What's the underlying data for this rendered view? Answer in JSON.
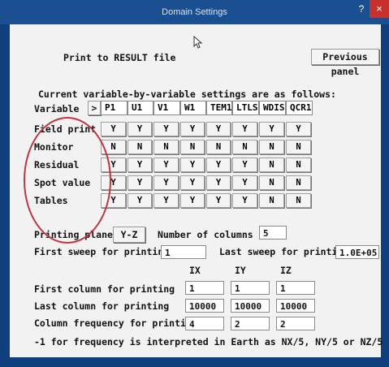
{
  "window": {
    "title": "Domain Settings",
    "help": "?",
    "close": "×"
  },
  "header": {
    "print_label": "Print to RESULT file",
    "prev_button": "Previous panel"
  },
  "settings_caption": "Current variable-by-variable settings are as follows:",
  "table": {
    "variable_label": "Variable",
    "next_button": ">",
    "variables": [
      "P1",
      "U1",
      "V1",
      "W1",
      "TEM1",
      "LTLS",
      "WDIS",
      "QCR1"
    ],
    "rows": [
      {
        "label": "Field print",
        "values": [
          "Y",
          "Y",
          "Y",
          "Y",
          "Y",
          "Y",
          "Y",
          "Y"
        ]
      },
      {
        "label": "Monitor",
        "values": [
          "N",
          "N",
          "N",
          "N",
          "N",
          "N",
          "N",
          "N"
        ]
      },
      {
        "label": "Residual",
        "values": [
          "Y",
          "Y",
          "Y",
          "Y",
          "Y",
          "Y",
          "N",
          "N"
        ]
      },
      {
        "label": "Spot value",
        "values": [
          "Y",
          "Y",
          "Y",
          "Y",
          "Y",
          "Y",
          "N",
          "N"
        ]
      },
      {
        "label": "Tables",
        "values": [
          "Y",
          "Y",
          "Y",
          "Y",
          "Y",
          "Y",
          "N",
          "N"
        ]
      }
    ]
  },
  "printing": {
    "plane_label": "Printing plane",
    "plane_value": "Y-Z",
    "columns_label": "Number of columns",
    "columns_value": "5",
    "first_sweep_label": "First sweep for printing",
    "first_sweep_value": "1",
    "last_sweep_label": "Last sweep for printing",
    "last_sweep_value": "1.0E+05",
    "axes": [
      "IX",
      "IY",
      "IZ"
    ],
    "first_col_label": "First column for printing",
    "first_col_values": [
      "1",
      "1",
      "1"
    ],
    "last_col_label": "Last  column for printing",
    "last_col_values": [
      "10000",
      "10000",
      "10000"
    ],
    "freq_label": "Column frequency for printing",
    "freq_values": [
      "4",
      "2",
      "2"
    ],
    "note": "-1 for frequency is interpreted in Earth as NX/5, NY/5 or NZ/5"
  }
}
